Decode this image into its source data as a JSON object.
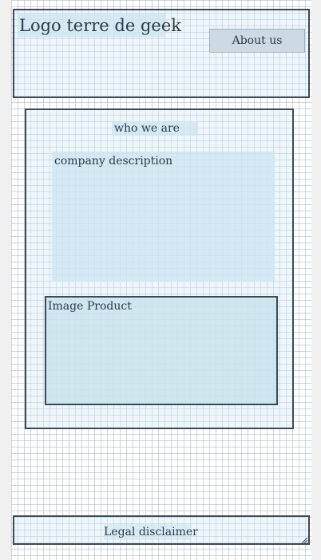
{
  "header": {
    "logo": "Logo terre de geek",
    "about_button": "About us"
  },
  "main": {
    "section_title": "who we are",
    "company_description": "company description",
    "image_product": "Image Product"
  },
  "footer": {
    "legal_disclaimer": "Legal disclaimer"
  },
  "icons": {
    "resize_handle": "resize-grip-icon"
  },
  "colors": {
    "frame_border": "#3b4a56",
    "frame_fill": "#d7ecf6",
    "button_fill": "#ccdbe3",
    "text": "#2b3a4a"
  }
}
